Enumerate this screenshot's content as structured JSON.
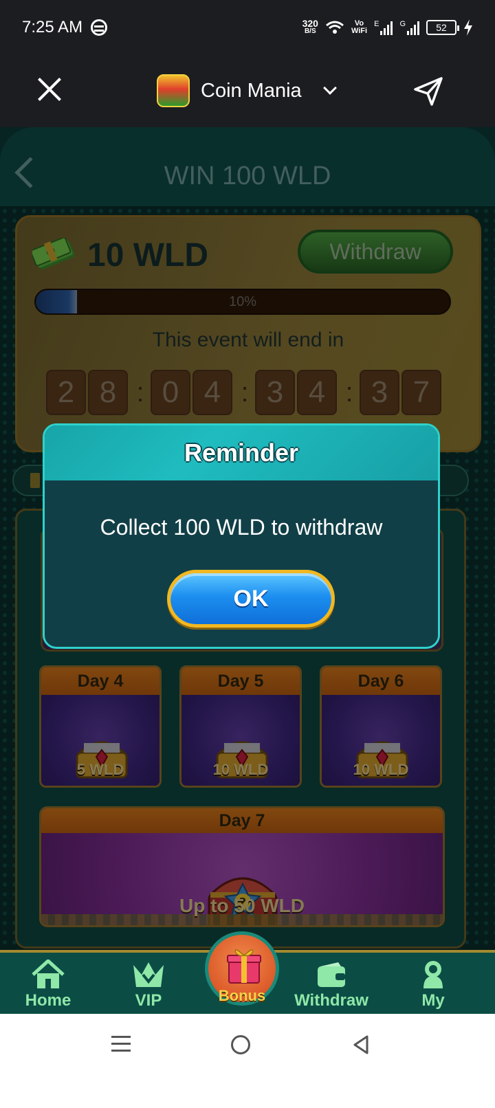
{
  "status": {
    "time": "7:25 AM",
    "speed_value": "320",
    "speed_unit": "B/S",
    "battery": "52"
  },
  "header": {
    "app_name": "Coin Mania"
  },
  "game": {
    "title": "WIN 100 WLD",
    "balance": "10 WLD",
    "withdraw_label": "Withdraw",
    "progress_label": "10%",
    "progress_fraction": 0.1,
    "event_text": "This event will end in",
    "countdown": [
      "2",
      "8",
      "0",
      "4",
      "3",
      "4",
      "3",
      "7"
    ]
  },
  "days": [
    {
      "label": "Day 4",
      "amount": "5 WLD"
    },
    {
      "label": "Day 5",
      "amount": "10 WLD"
    },
    {
      "label": "Day 6",
      "amount": "10 WLD"
    }
  ],
  "day7": {
    "label": "Day 7",
    "amount": "Up to 50 WLD"
  },
  "modal": {
    "title": "Reminder",
    "message": "Collect 100 WLD to withdraw",
    "ok_label": "OK"
  },
  "nav": {
    "home": "Home",
    "vip": "VIP",
    "bonus": "Bonus",
    "withdraw": "Withdraw",
    "my": "My"
  }
}
